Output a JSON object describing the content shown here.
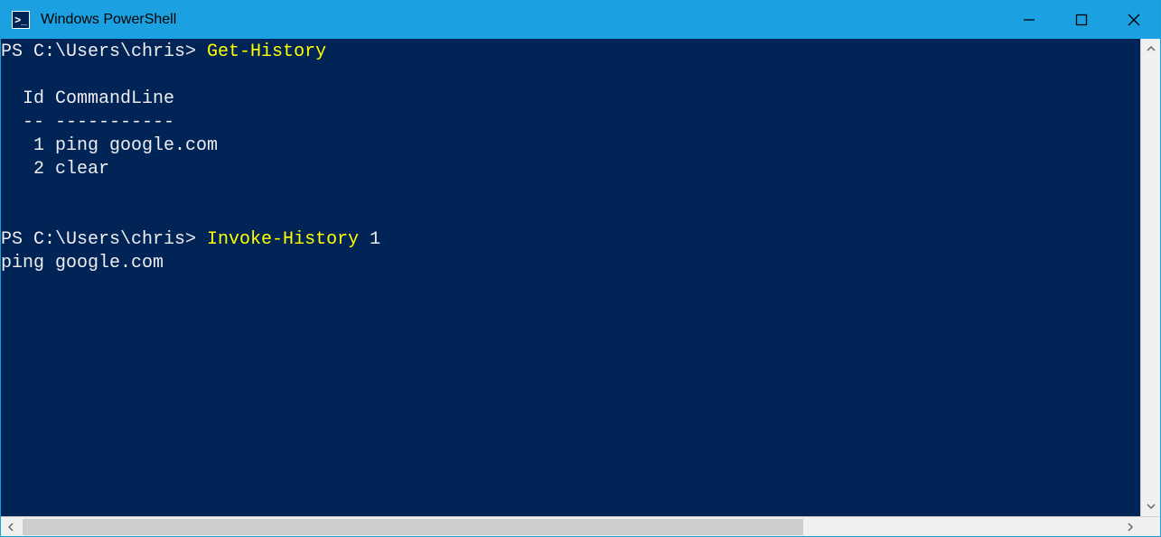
{
  "window": {
    "title": "Windows PowerShell",
    "icon_glyph": ">_"
  },
  "terminal": {
    "lines": [
      {
        "segments": [
          {
            "text": "PS C:\\Users\\chris> ",
            "cls": "prompt"
          },
          {
            "text": "Get-History",
            "cls": "cmd-yellow"
          }
        ]
      },
      {
        "segments": [
          {
            "text": "",
            "cls": "cmd-white"
          }
        ]
      },
      {
        "segments": [
          {
            "text": "  Id CommandLine",
            "cls": "cmd-white"
          }
        ]
      },
      {
        "segments": [
          {
            "text": "  -- -----------",
            "cls": "cmd-white"
          }
        ]
      },
      {
        "segments": [
          {
            "text": "   1 ping google.com",
            "cls": "cmd-white"
          }
        ]
      },
      {
        "segments": [
          {
            "text": "   2 clear",
            "cls": "cmd-white"
          }
        ]
      },
      {
        "segments": [
          {
            "text": "",
            "cls": "cmd-white"
          }
        ]
      },
      {
        "segments": [
          {
            "text": "",
            "cls": "cmd-white"
          }
        ]
      },
      {
        "segments": [
          {
            "text": "PS C:\\Users\\chris> ",
            "cls": "prompt"
          },
          {
            "text": "Invoke-History ",
            "cls": "cmd-yellow"
          },
          {
            "text": "1",
            "cls": "cmd-white"
          }
        ]
      },
      {
        "segments": [
          {
            "text": "ping google.com",
            "cls": "cmd-white"
          }
        ]
      }
    ]
  }
}
